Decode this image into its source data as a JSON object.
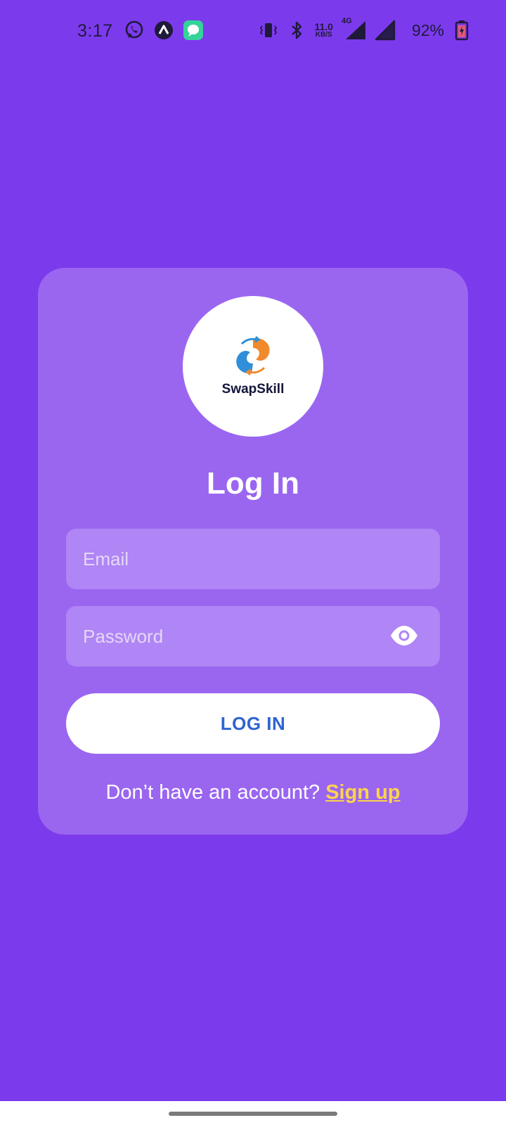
{
  "status_bar": {
    "time": "3:17",
    "net_speed": "11.0",
    "net_unit": "KB/S",
    "network": "4G",
    "battery": "92%",
    "notification_icons": [
      "whatsapp-icon",
      "app-a-icon",
      "chat-bubble-icon"
    ],
    "system_icons": [
      "vibrate-icon",
      "bluetooth-icon",
      "signal-icon",
      "signal-icon",
      "battery-charging-icon"
    ]
  },
  "logo": {
    "name": "SwapSkill"
  },
  "login": {
    "title": "Log In",
    "email_placeholder": "Email",
    "password_placeholder": "Password",
    "button_label": "LOG IN",
    "signup_prompt": "Don’t have an account?",
    "signup_link": "Sign up"
  },
  "colors": {
    "background": "#7c3aed",
    "card": "#9a66f0",
    "field": "#b085f5",
    "button_text": "#2f64d0",
    "link": "#fcd34d"
  }
}
